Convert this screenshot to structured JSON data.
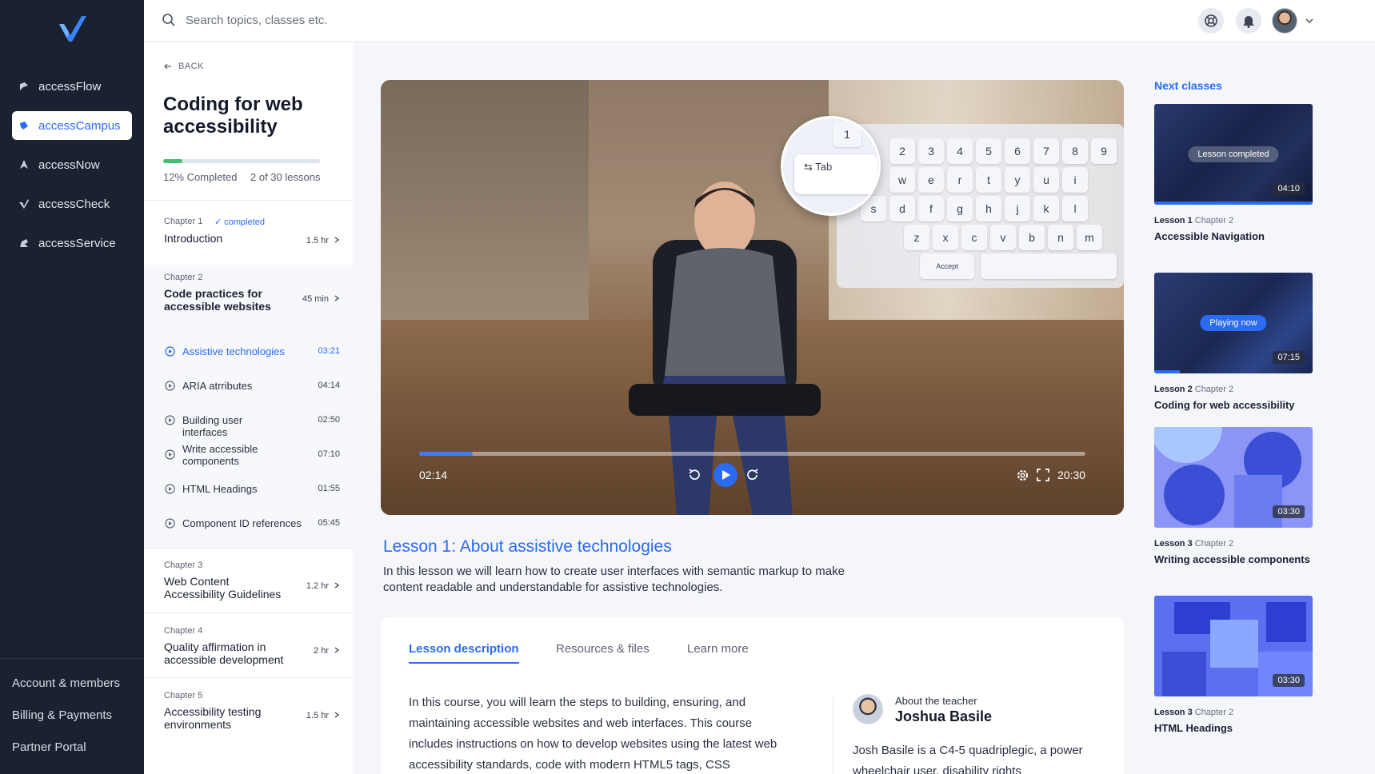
{
  "nav": {
    "items": [
      {
        "label": "accessFlow",
        "icon": "accessflow-icon"
      },
      {
        "label": "accessCampus",
        "icon": "accesscampus-icon"
      },
      {
        "label": "accessNow",
        "icon": "accessnow-icon"
      },
      {
        "label": "accessCheck",
        "icon": "accesscheck-icon"
      },
      {
        "label": "accessService",
        "icon": "accessservice-icon"
      }
    ],
    "active_item": "accessCampus",
    "bottom": [
      "Account & members",
      "Billing & Payments",
      "Partner Portal"
    ]
  },
  "topbar": {
    "search_placeholder": "Search topics, classes etc."
  },
  "course": {
    "back_label": "BACK",
    "title": "Coding for web accessibility",
    "progress_percent": 12,
    "progress_label": "12% Completed",
    "lessons_label": "2 of 30 lessons",
    "chapters": [
      {
        "label": "Chapter 1",
        "status": "completed",
        "name": "Introduction",
        "duration": "1.5 hr"
      },
      {
        "label": "Chapter 2",
        "name": "Code practices for accessible websites",
        "duration": "45 min",
        "lessons": [
          {
            "name": "Assistive technologies",
            "time": "03:21",
            "active": true
          },
          {
            "name": "ARIA atrributes",
            "time": "04:14"
          },
          {
            "name": "Building user interfaces",
            "time": "02:50"
          },
          {
            "name": "Write accessible components",
            "time": "07:10"
          },
          {
            "name": "HTML Headings",
            "time": "01:55"
          },
          {
            "name": "Component ID references",
            "time": "05:45"
          }
        ]
      },
      {
        "label": "Chapter 3",
        "name": "Web Content Accessibility Guidelines",
        "duration": "1.2 hr"
      },
      {
        "label": "Chapter 4",
        "name": "Quality affirmation in accessible development",
        "duration": "2 hr"
      },
      {
        "label": "Chapter 5",
        "name": "Accessibility testing environments",
        "duration": "1.5 hr"
      }
    ]
  },
  "player": {
    "current_time": "02:14",
    "total_time": "20:30",
    "progress_fraction": 0.08,
    "keyboard": {
      "row1": [
        "2",
        "3",
        "4",
        "5",
        "6",
        "7",
        "8",
        "9"
      ],
      "row2": [
        "w",
        "e",
        "r",
        "t",
        "y",
        "u",
        "i"
      ],
      "row3": [
        "s",
        "d",
        "f",
        "g",
        "h",
        "j",
        "k",
        "l"
      ],
      "row4": [
        "z",
        "x",
        "c",
        "v",
        "b",
        "n",
        "m"
      ],
      "accept_key": "Accept",
      "magnified_key": "Tab",
      "magnified_top": "1"
    }
  },
  "lesson": {
    "title": "Lesson 1: About assistive technologies",
    "description": "In this lesson we will learn how to create user interfaces with semantic markup to make content readable and understandable for assistive technologies."
  },
  "tabs": [
    "Lesson description",
    "Resources & files",
    "Learn more"
  ],
  "description_body": "In this course, you will learn the steps to building, ensuring, and maintaining accessible websites and web interfaces. This course includes instructions on how to develop websites using the latest web accessibility standards, code with modern HTML5 tags, CSS",
  "teacher": {
    "about_label": "About the teacher",
    "name": "Joshua Basile",
    "bio": "Josh Basile is a C4-5 quadriplegic, a power wheelchair user, disability rights"
  },
  "next_classes": {
    "title": "Next classes",
    "cards": [
      {
        "lesson": "Lesson 1",
        "chapter": "Chapter 2",
        "name": "Accessible Navigation",
        "duration": "04:10",
        "badge": "Lesson completed",
        "watched_fraction": 1.0
      },
      {
        "lesson": "Lesson 2",
        "chapter": "Chapter 2",
        "name": "Coding for web accessibility",
        "duration": "07:15",
        "badge": "Playing now",
        "watched_fraction": 0.16
      },
      {
        "lesson": "Lesson 3",
        "chapter": "Chapter 2",
        "name": "Writing accessible components",
        "duration": "03:30"
      },
      {
        "lesson": "Lesson 3",
        "chapter": "Chapter 2",
        "name": "HTML Headings",
        "duration": "03:30"
      }
    ]
  },
  "colors": {
    "accent": "#2a6bf2",
    "sidebar_bg": "#1a2131",
    "progress_green": "#45be70"
  }
}
